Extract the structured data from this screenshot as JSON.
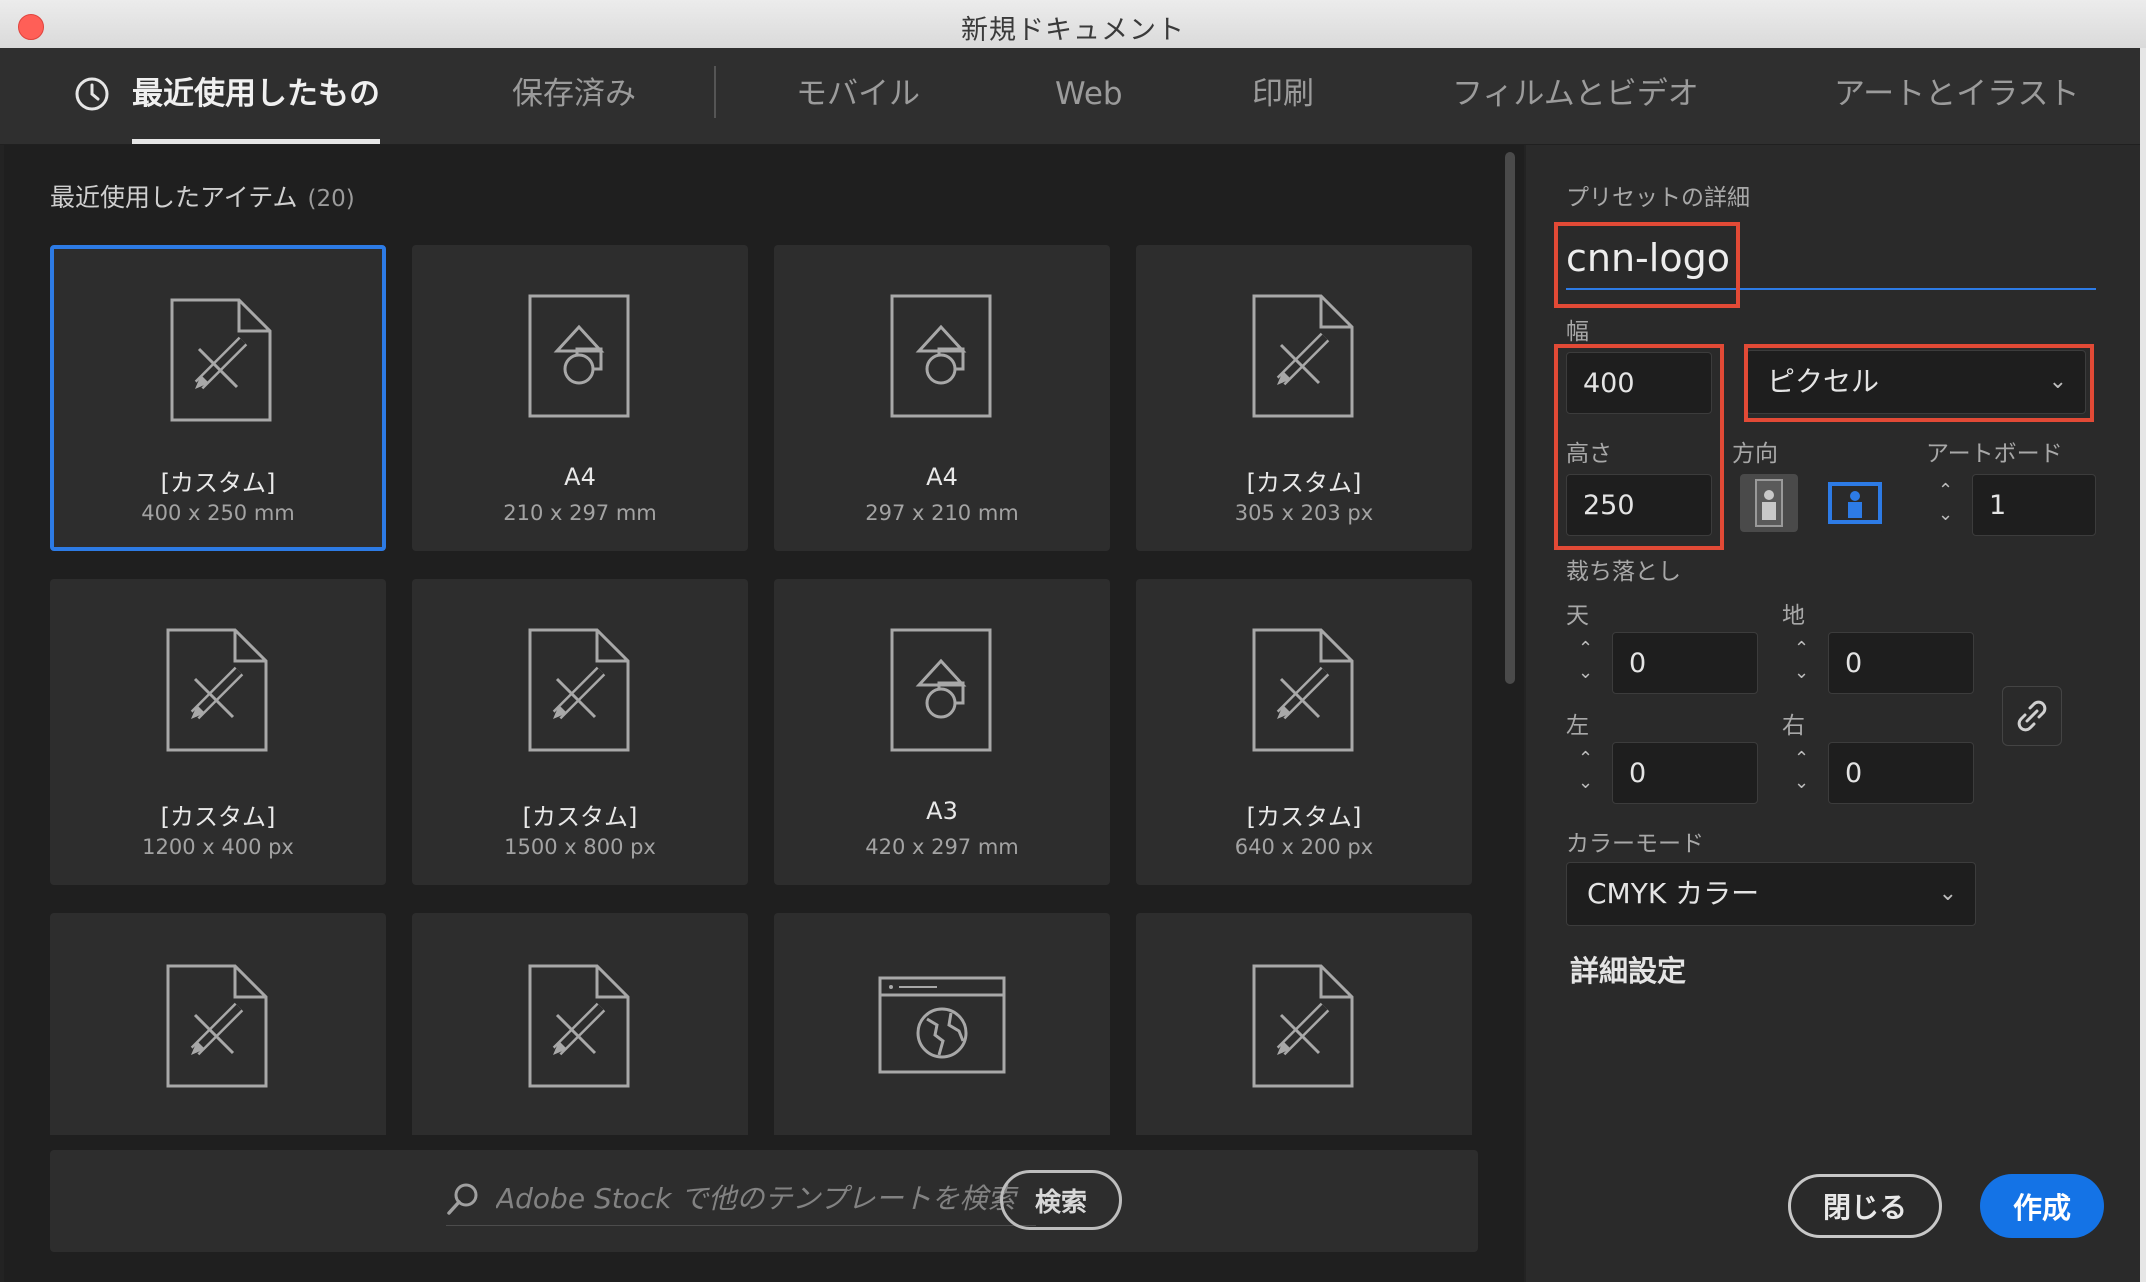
{
  "window": {
    "title": "新規ドキュメント"
  },
  "tabs": [
    {
      "label": "最近使用したもの",
      "active": true
    },
    {
      "label": "保存済み"
    },
    {
      "label": "モバイル"
    },
    {
      "label": "Web"
    },
    {
      "label": "印刷"
    },
    {
      "label": "フィルムとビデオ"
    },
    {
      "label": "アートとイラスト"
    }
  ],
  "recent": {
    "heading": "最近使用したアイテム",
    "count": "(20)",
    "items": [
      {
        "name": "[カスタム]",
        "size": "400 x 250 mm",
        "icon": "custom-document-icon",
        "selected": true
      },
      {
        "name": "A4",
        "size": "210 x 297 mm",
        "icon": "print-document-icon"
      },
      {
        "name": "A4",
        "size": "297 x 210 mm",
        "icon": "print-document-icon"
      },
      {
        "name": "[カスタム]",
        "size": "305 x 203 px",
        "icon": "custom-document-icon"
      },
      {
        "name": "[カスタム]",
        "size": "1200 x 400 px",
        "icon": "custom-document-icon"
      },
      {
        "name": "[カスタム]",
        "size": "1500 x 800 px",
        "icon": "custom-document-icon"
      },
      {
        "name": "A3",
        "size": "420 x 297 mm",
        "icon": "print-document-icon"
      },
      {
        "name": "[カスタム]",
        "size": "640 x 200 px",
        "icon": "custom-document-icon"
      },
      {
        "icon": "custom-document-icon"
      },
      {
        "icon": "custom-document-icon"
      },
      {
        "icon": "web-document-icon"
      },
      {
        "icon": "custom-document-icon"
      }
    ]
  },
  "search": {
    "placeholder": "Adobe Stock で他のテンプレートを検索",
    "button": "検索"
  },
  "preset": {
    "heading": "プリセットの詳細",
    "name": "cnn-logo",
    "width_label": "幅",
    "width": "400",
    "unit": "ピクセル",
    "height_label": "高さ",
    "height": "250",
    "orientation_label": "方向",
    "artboard_label": "アートボード",
    "artboard": "1",
    "bleed_label": "裁ち落とし",
    "bleed": {
      "top_label": "天",
      "top": "0",
      "bottom_label": "地",
      "bottom": "0",
      "left_label": "左",
      "left": "0",
      "right_label": "右",
      "right": "0"
    },
    "color_mode_label": "カラーモード",
    "color_mode": "CMYK カラー",
    "advanced": "詳細設定"
  },
  "actions": {
    "close": "閉じる",
    "create": "作成"
  },
  "colors": {
    "accent": "#1473e6",
    "highlight": "#e24a36",
    "selected_border": "#2d7be5"
  }
}
